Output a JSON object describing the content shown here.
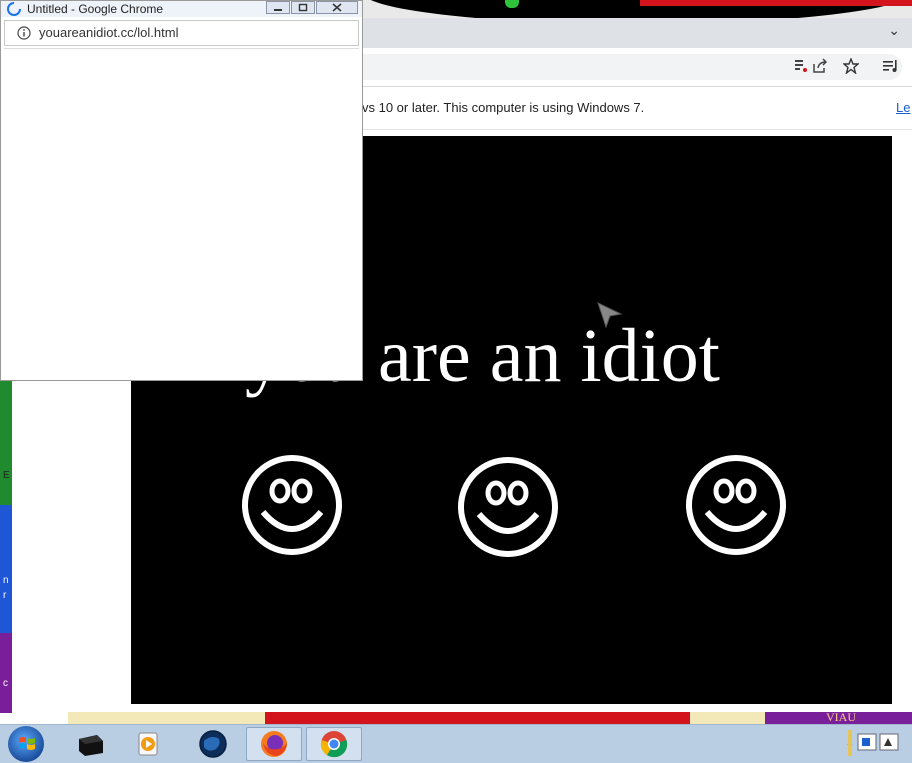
{
  "popup": {
    "title": "Untitled - Google Chrome",
    "url": "youareanidiot.cc/lol.html"
  },
  "main_window": {
    "infobar_text": "vs 10 or later. This computer is using Windows 7.",
    "infobar_link": "Le"
  },
  "page": {
    "headline": "you are an idiot",
    "smiley_count": 3
  },
  "background": {
    "left_text_1": "E",
    "left_text_2": "n",
    "left_text_3": "r",
    "left_text_4": "c",
    "bottom_text": "VIAU"
  },
  "taskbar": {
    "items": [
      {
        "name": "start",
        "icon": "windows-orb-icon"
      },
      {
        "name": "app-black",
        "icon": "black-box-icon"
      },
      {
        "name": "media-player",
        "icon": "media-player-icon"
      },
      {
        "name": "globe",
        "icon": "globe-icon"
      },
      {
        "name": "firefox",
        "icon": "firefox-icon"
      },
      {
        "name": "chrome",
        "icon": "chrome-icon"
      }
    ]
  },
  "colors": {
    "panel": "#000000",
    "text": "#ffffff",
    "taskbar": "#b9cde3"
  }
}
